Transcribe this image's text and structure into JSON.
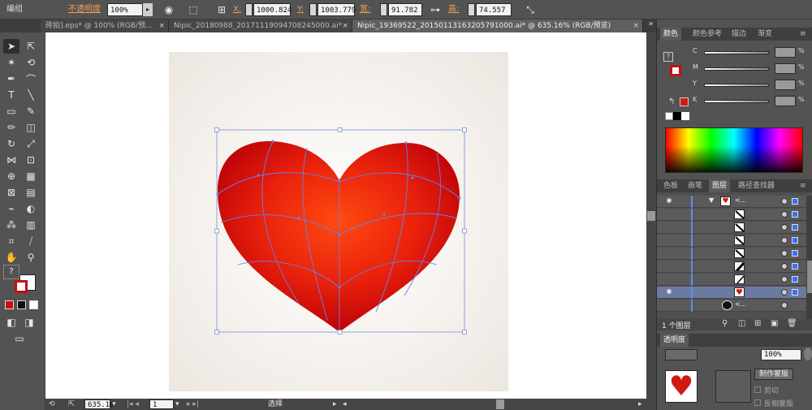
{
  "control_bar": {
    "group_label": "编组",
    "opacity_label": "不透明度",
    "opacity_value": "100%",
    "x_label": "X:",
    "x_value": "1000.824",
    "y_label": "Y:",
    "y_value": "1003.779",
    "w_label": "宽:",
    "w_value": "91.782 pt",
    "h_label": "高:",
    "h_value": "74.557 pt"
  },
  "tabs": [
    {
      "label": "砖拍].eps* @ 100% (RGB/预...",
      "active": false
    },
    {
      "label": "Nipic_20180988_20171119094708245000.ai*",
      "active": false
    },
    {
      "label": "Nipic_19369522_20150113163205791000.ai* @ 635.16% (RGB/预览)",
      "active": true
    }
  ],
  "status_bar": {
    "zoom": "635.16",
    "page": "1",
    "mode": "选择"
  },
  "color_panel": {
    "tabs": [
      "颜色",
      "颜色参考",
      "描边",
      "渐变"
    ],
    "active_tab": "颜色",
    "channels": [
      {
        "name": "C",
        "unit": "%"
      },
      {
        "name": "M",
        "unit": "%"
      },
      {
        "name": "Y",
        "unit": "%"
      },
      {
        "name": "K",
        "unit": "%"
      }
    ],
    "fill_color": "#d01a10"
  },
  "layers_panel": {
    "tabs": [
      "色板",
      "画笔",
      "图层",
      "路径查找器"
    ],
    "active_tab": "图层",
    "group_name": "<...",
    "bottom_item_name": "<...",
    "layer_count": "1 个图层"
  },
  "transparency_panel": {
    "tab": "透明度",
    "opacity_value": "100%",
    "mask_button": "制作蒙版",
    "clip_label": "剪切",
    "invert_label": "反相蒙版"
  },
  "colors": {
    "heart_center": "#ff4a10",
    "heart_edge": "#b80008",
    "mesh": "#6a7fe8",
    "selection": "#7a8ed8"
  }
}
